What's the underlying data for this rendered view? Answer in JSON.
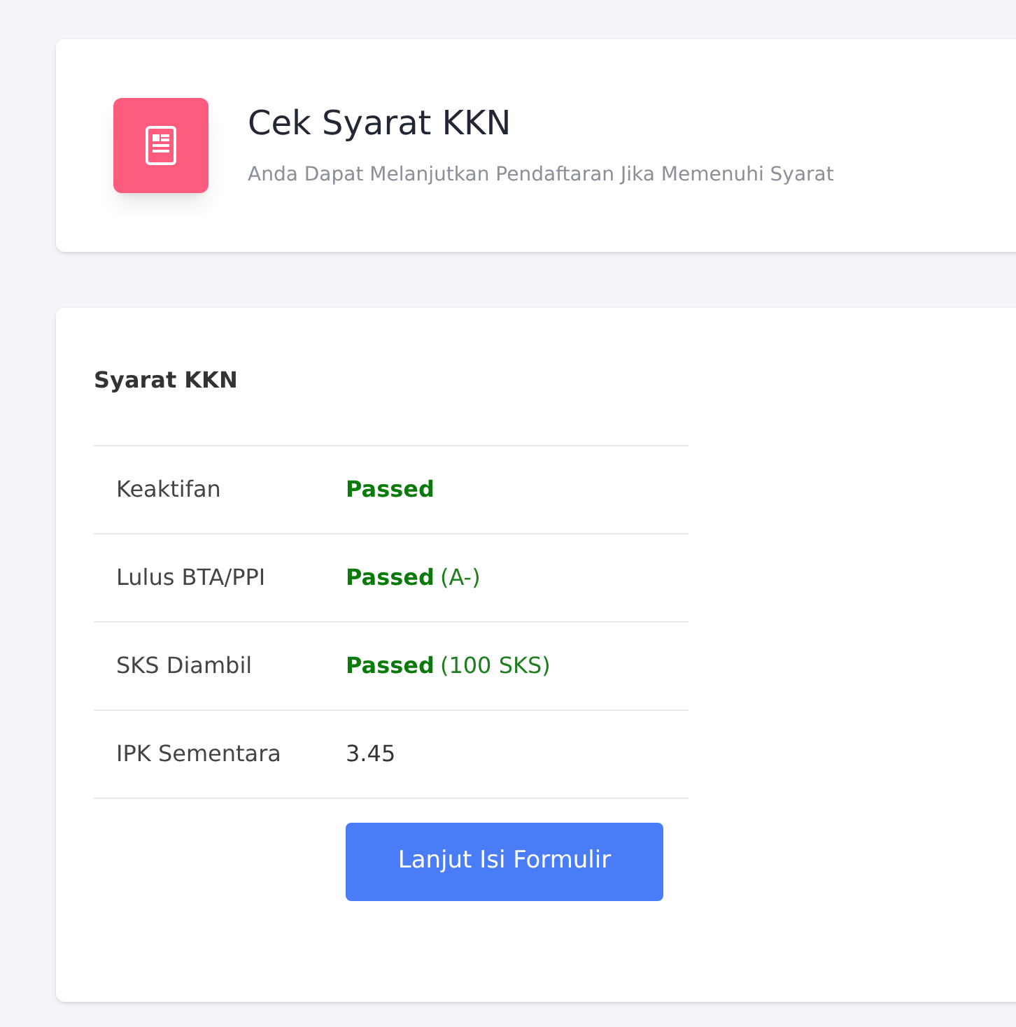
{
  "header": {
    "title": "Cek Syarat KKN",
    "subtitle": "Anda Dapat Melanjutkan Pendaftaran Jika Memenuhi Syarat"
  },
  "requirements": {
    "title": "Syarat KKN",
    "rows": [
      {
        "label": "Keaktifan",
        "kind": "status",
        "status": "Passed"
      },
      {
        "label": "Lulus BTA/PPI",
        "kind": "status",
        "status": "Passed",
        "detail": "(A-)"
      },
      {
        "label": "SKS Diambil",
        "kind": "status",
        "status": "Passed",
        "detail": "(100 SKS)"
      },
      {
        "label": "IPK Sementara",
        "kind": "text",
        "value": "3.45"
      }
    ],
    "button": "Lanjut Isi Formulir"
  }
}
